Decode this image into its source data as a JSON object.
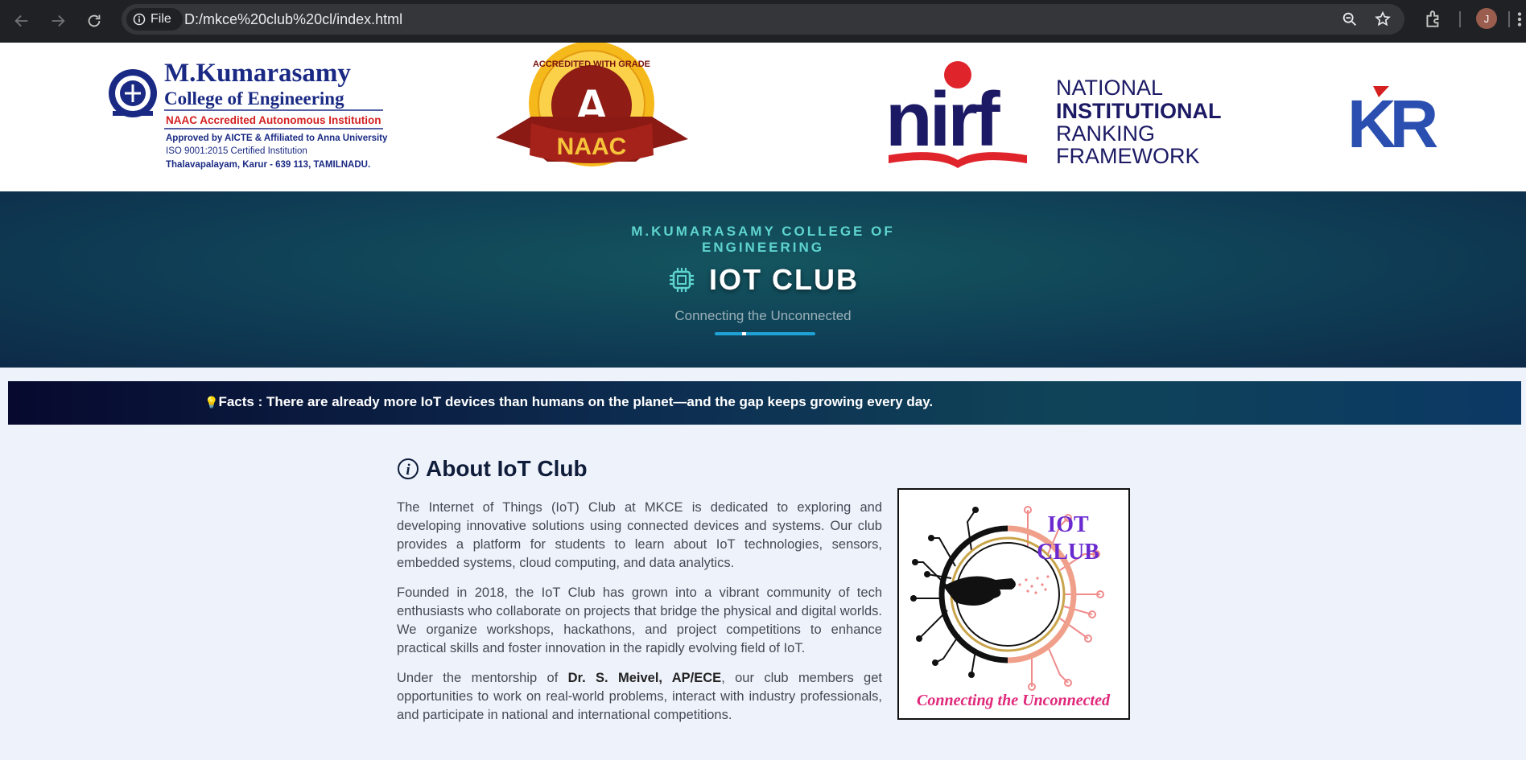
{
  "browser": {
    "site_chip_label": "File",
    "url": "D:/mkce%20club%20cl/index.html",
    "avatar_initial": "J"
  },
  "logos": {
    "mkce": {
      "name_line1": "M.Kumarasamy",
      "name_line2": "College of Engineering",
      "accreditation": "NAAC Accredited Autonomous Institution",
      "approval": "Approved by AICTE & Affiliated to Anna University",
      "iso": "ISO 9001:2015 Certified Institution",
      "address": "Thalavapalayam, Karur - 639 113, TAMILNADU."
    },
    "naac": {
      "ring_text": "ACCREDITED WITH GRADE",
      "grade": "A",
      "ribbon": "NAAC"
    },
    "nirf": {
      "mark": "nirf",
      "line1": "NATIONAL",
      "line2": "INSTITUTIONAL",
      "line3": "RANKING",
      "line4": "FRAMEWORK"
    },
    "kr": {
      "mark": "KR"
    }
  },
  "hero": {
    "college_line1": "M.KUMARASAMY COLLEGE OF",
    "college_line2": "ENGINEERING",
    "title": "IOT CLUB",
    "tagline": "Connecting the Unconnected"
  },
  "facts": {
    "icon": "lightbulb-icon",
    "text": "Facts : There are already more IoT devices than humans on the planet—and the gap keeps growing every day."
  },
  "about": {
    "title": "About IoT Club",
    "p1": "The Internet of Things (IoT) Club at MKCE is dedicated to exploring and developing innovative solutions using connected devices and systems. Our club provides a platform for students to learn about IoT technologies, sensors, embedded systems, cloud computing, and data analytics.",
    "p2": "Founded in 2018, the IoT Club has grown into a vibrant community of tech enthusiasts who collaborate on projects that bridge the physical and digital worlds. We organize workshops, hackathons, and project competitions to enhance practical skills and foster innovation in the rapidly evolving field of IoT.",
    "p3_prefix": "Under the mentorship of ",
    "p3_mentor": "Dr. S. Meivel, AP/ECE",
    "p3_suffix": ", our club members get opportunities to work on real-world problems, interact with industry professionals, and participate in national and international competitions.",
    "logo_title_line1": "IOT",
    "logo_title_line2": "CLUB",
    "logo_tagline": "Connecting the Unconnected"
  }
}
